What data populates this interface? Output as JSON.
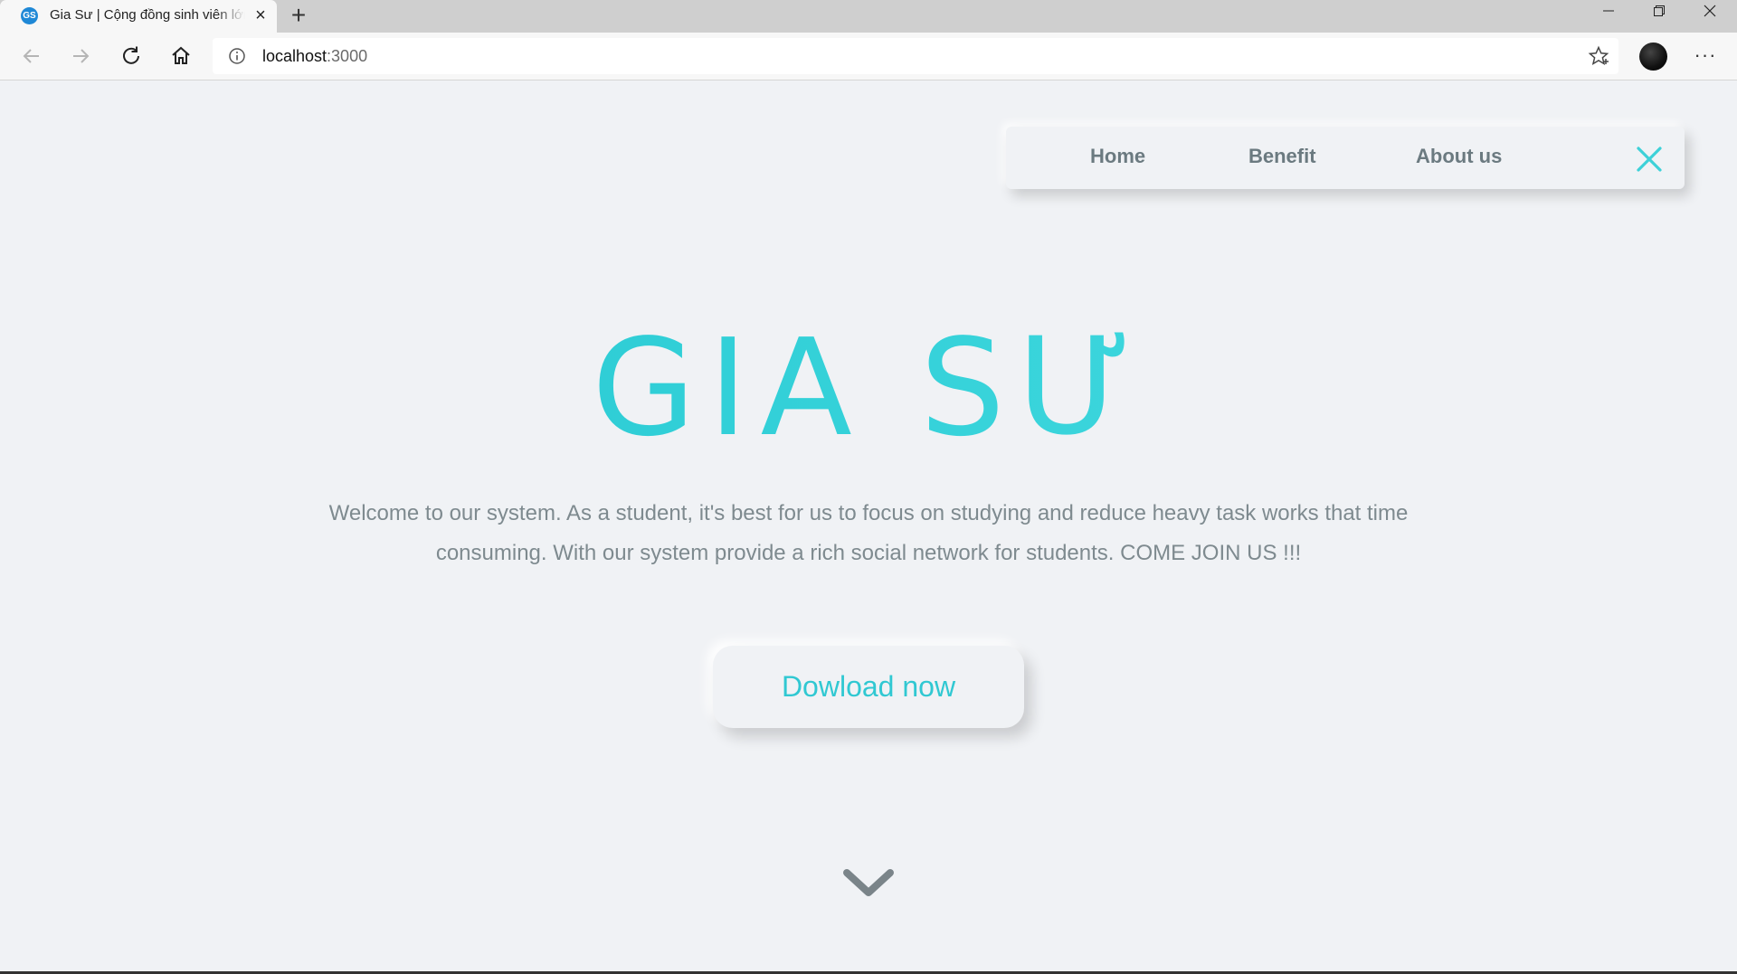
{
  "browser": {
    "tab": {
      "favicon_text": "GS",
      "title": "Gia Sư | Cộng đồng sinh viên lớn",
      "close_glyph": "×"
    },
    "new_tab_glyph": "+",
    "address": {
      "host": "localhost",
      "port": ":3000"
    },
    "more_glyph": "···",
    "icons": [
      "back-icon",
      "forward-icon",
      "reload-icon",
      "home-icon",
      "info-icon",
      "star-icon",
      "minimize-icon",
      "maximize-icon",
      "close-icon"
    ]
  },
  "nav": {
    "items": [
      {
        "label": "Home"
      },
      {
        "label": "Benefit"
      },
      {
        "label": "About us"
      }
    ]
  },
  "hero": {
    "title": "GIA SƯ",
    "description": "Welcome to our system. As a student, it's best for us to focus on studying and reduce heavy task works that time consuming. With our system provide a rich social network for students. COME JOIN US !!!",
    "button_label": "Dowload now"
  },
  "colors": {
    "accent": "#2fcfd6",
    "text_muted": "#7e8a8f",
    "nav_text": "#6b7a80",
    "background": "#f0f2f5"
  }
}
